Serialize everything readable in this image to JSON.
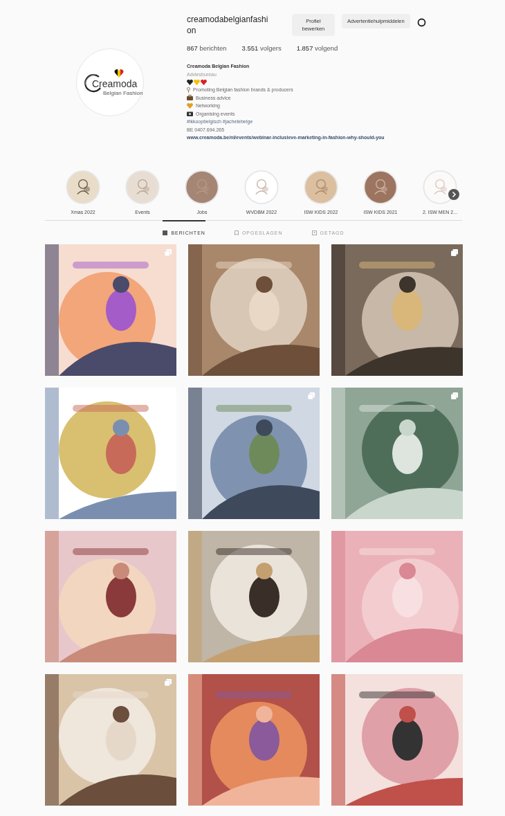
{
  "profile": {
    "username": "creamodabelgianfashion",
    "logo_text": "Creamoda",
    "logo_subtext": "Belgian Fashion",
    "buttons": [
      "Profiel bewerken",
      "Advertentiehulpmiddelen"
    ],
    "stats": [
      {
        "number": "867",
        "label": "berichten"
      },
      {
        "number": "3.551",
        "label": "volgers"
      },
      {
        "number": "1.857",
        "label": "volgend"
      }
    ],
    "name": "Creamoda Belgian Fashion",
    "category": "Adviesbureau",
    "bio": [
      {
        "kind": "pin",
        "text": "Promoting Belgian fashion brands & producers"
      },
      {
        "kind": "briefcase",
        "text": "Business advice"
      },
      {
        "kind": "heart",
        "text": "Networking"
      },
      {
        "kind": "camera",
        "text": "Organising events"
      }
    ],
    "hashtags": "#ikkoopbelgisch #jachetebelge",
    "vat": "BE 0407.694.265",
    "link": "www.creamoda.be/nl/events/webinar-inclusieve-marketing-in-fashion-why-should-you"
  },
  "highlights": [
    {
      "label": "Xmas 2022"
    },
    {
      "label": "Events"
    },
    {
      "label": "Jobs"
    },
    {
      "label": "WVDBM 2022"
    },
    {
      "label": "ISW KIDS 2022"
    },
    {
      "label": "ISW KIDS 2021"
    },
    {
      "label": "2. ISW MEN 2..."
    }
  ],
  "tabs": [
    {
      "label": "BERICHTEN",
      "selected": true
    },
    {
      "label": "OPGESLAGEN",
      "selected": false
    },
    {
      "label": "GETAGD",
      "selected": false
    }
  ],
  "posts": [
    {
      "kind": "picture",
      "multiple": true
    },
    {
      "kind": "picture",
      "multiple": false
    },
    {
      "kind": "picture",
      "multiple": true
    },
    {
      "kind": "picture",
      "multiple": false
    },
    {
      "kind": "picture",
      "multiple": true
    },
    {
      "kind": "picture",
      "multiple": true
    },
    {
      "kind": "picture",
      "multiple": false
    },
    {
      "kind": "picture",
      "multiple": false
    },
    {
      "kind": "picture",
      "multiple": false
    },
    {
      "kind": "picture",
      "multiple": true
    },
    {
      "kind": "picture",
      "multiple": false
    },
    {
      "kind": "picture",
      "multiple": false
    }
  ]
}
